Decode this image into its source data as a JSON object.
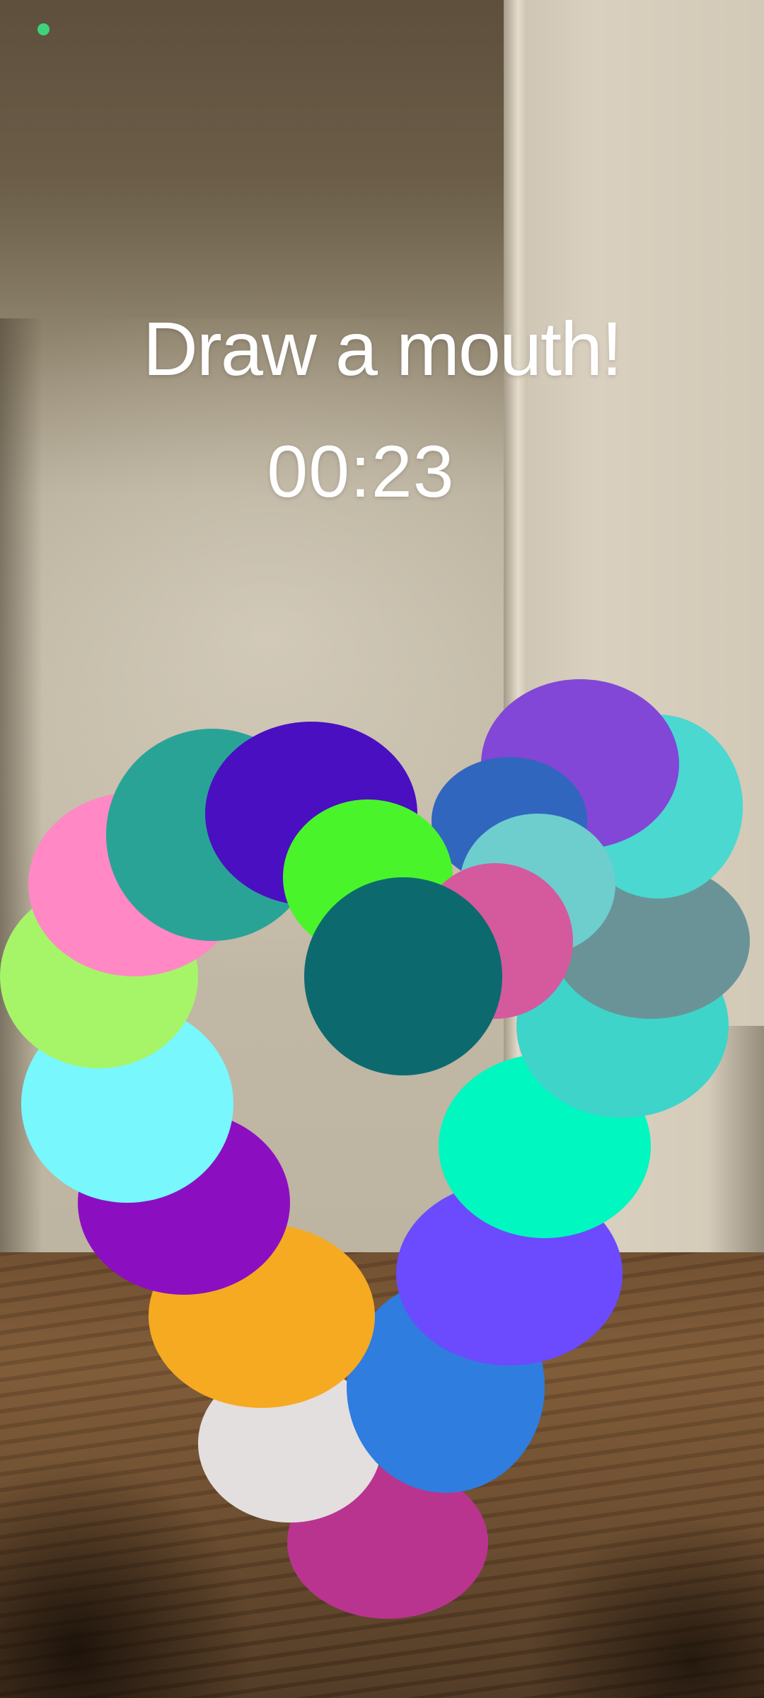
{
  "prompt": {
    "text": "Draw a mouth!"
  },
  "timer": {
    "value": "00:23"
  },
  "status_indicator": {
    "color": "#3ed37a"
  },
  "drawing": {
    "stroke_colors": [
      "#b9348f",
      "#e3dfde",
      "#2f7ddf",
      "#f6aa22",
      "#6b4bfd",
      "#8b0fc1",
      "#00f7c0",
      "#78f7fd",
      "#3ed4c9",
      "#a6f569",
      "#6a9398",
      "#ff88c5",
      "#4ad8d0",
      "#2aa397",
      "#8247d6",
      "#4a0fc0",
      "#3166bf",
      "#49f52a",
      "#6dcecd",
      "#d45a9d",
      "#0c6a6f"
    ]
  }
}
